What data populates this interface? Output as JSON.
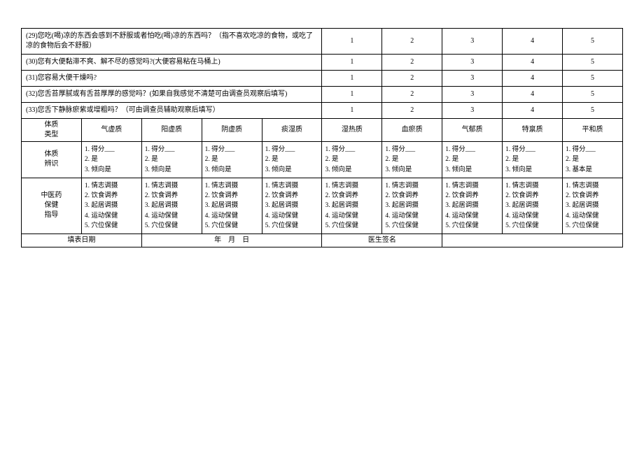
{
  "questions": [
    {
      "text": "(29)您吃(喝)凉的东西会感到不舒服或者怕吃(喝)凉的东西吗？（指不喜欢吃凉的食物，或吃了凉的食物后会不舒服）",
      "opts": [
        "1",
        "2",
        "3",
        "4",
        "5"
      ]
    },
    {
      "text": "(30)您有大便黏滞不爽、解不尽的感觉吗?(大便容易粘在马桶上)",
      "opts": [
        "1",
        "2",
        "3",
        "4",
        "5"
      ]
    },
    {
      "text": "(31)您容易大便干燥吗?",
      "opts": [
        "1",
        "2",
        "3",
        "4",
        "5"
      ]
    },
    {
      "text": "(32)您舌苔厚腻或有舌苔厚厚的感觉吗？(如果自我感觉不清楚可由调查员观察后填写)",
      "opts": [
        "1",
        "2",
        "3",
        "4",
        "5"
      ]
    },
    {
      "text": "(33)您舌下静脉瘀紫或增粗吗？（可由调查员辅助观察后填写）",
      "opts": [
        "1",
        "2",
        "3",
        "4",
        "5"
      ]
    }
  ],
  "typeHeader": "体质\n类型",
  "types": [
    "气虚质",
    "阳虚质",
    "阴虚质",
    "痰湿质",
    "湿热质",
    "血瘀质",
    "气郁质",
    "特禀质",
    "平和质"
  ],
  "identHeader": "体质\n辨识",
  "identRows": {
    "standard": [
      "1. 得分___",
      "2. 是",
      "3. 倾向是"
    ],
    "last": [
      "1. 得分___",
      "2. 是",
      "3. 基本是"
    ]
  },
  "guideHeader": "中医药\n保健\n指导",
  "guideRows": [
    "1. 情志调摄",
    "2. 饮食调养",
    "3. 起居调摄",
    "4. 运动保健",
    "5. 穴位保健"
  ],
  "footer": {
    "dateLabel": "填表日期",
    "dateValue": "年　月　日",
    "doctorLabel": "医生签名"
  }
}
